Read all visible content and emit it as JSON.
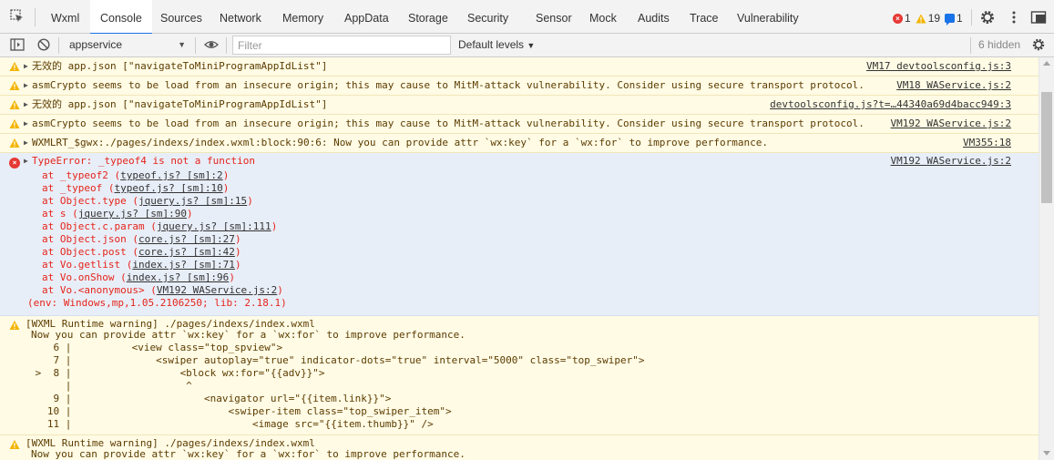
{
  "tabs": [
    {
      "label": "Wxml"
    },
    {
      "label": "Console"
    },
    {
      "label": "Sources"
    },
    {
      "label": "Network"
    },
    {
      "label": "Memory"
    },
    {
      "label": "AppData"
    },
    {
      "label": "Storage"
    },
    {
      "label": "Security"
    },
    {
      "label": "Sensor"
    },
    {
      "label": "Mock"
    },
    {
      "label": "Audits"
    },
    {
      "label": "Trace"
    },
    {
      "label": "Vulnerability"
    }
  ],
  "active_tab": "Console",
  "counts": {
    "errors": "1",
    "warnings": "19",
    "info": "1"
  },
  "toolbar": {
    "context": "appservice",
    "filter_placeholder": "Filter",
    "levels": "Default levels",
    "hidden": "6 hidden"
  },
  "colors": {
    "warn_bg": "#fffbe5",
    "error_bg": "#e8eef8",
    "error_text": "#e5241a",
    "accent": "#1a73e8"
  },
  "messages": [
    {
      "level": "warning",
      "text": "无效的 app.json [\"navigateToMiniProgramAppIdList\"]",
      "source": "VM17 devtoolsconfig.js:3"
    },
    {
      "level": "warning",
      "text": "asmCrypto seems to be load from an insecure origin; this may cause to MitM-attack vulnerability. Consider using secure transport protocol.",
      "source": "VM18 WAService.js:2"
    },
    {
      "level": "warning",
      "text": "无效的 app.json [\"navigateToMiniProgramAppIdList\"]",
      "source": "devtoolsconfig.js?t=…44340a69d4bacc949:3"
    },
    {
      "level": "warning",
      "text": "asmCrypto seems to be load from an insecure origin; this may cause to MitM-attack vulnerability. Consider using secure transport protocol.",
      "source": "VM192 WAService.js:2"
    },
    {
      "level": "warning",
      "text": "WXMLRT_$gwx:./pages/indexs/index.wxml:block:90:6: Now you can provide attr `wx:key` for a `wx:for` to improve performance.",
      "source": "VM355:18"
    }
  ],
  "error": {
    "text": "TypeError: _typeof4 is not a function",
    "source": "VM192 WAService.js:2",
    "stack": [
      {
        "prefix": "at _typeof2 (",
        "link": "typeof.js? [sm]:2",
        "suffix": ")"
      },
      {
        "prefix": "at _typeof (",
        "link": "typeof.js? [sm]:10",
        "suffix": ")"
      },
      {
        "prefix": "at Object.type (",
        "link": "jquery.js? [sm]:15",
        "suffix": ")"
      },
      {
        "prefix": "at s (",
        "link": "jquery.js? [sm]:90",
        "suffix": ")"
      },
      {
        "prefix": "at Object.c.param (",
        "link": "jquery.js? [sm]:111",
        "suffix": ")"
      },
      {
        "prefix": "at Object.json (",
        "link": "core.js? [sm]:27",
        "suffix": ")"
      },
      {
        "prefix": "at Object.post (",
        "link": "core.js? [sm]:42",
        "suffix": ")"
      },
      {
        "prefix": "at Vo.getlist (",
        "link": "index.js? [sm]:71",
        "suffix": ")"
      },
      {
        "prefix": "at Vo.onShow (",
        "link": "index.js? [sm]:96",
        "suffix": ")"
      },
      {
        "prefix": "at Vo.<anonymous> (",
        "link": "VM192 WAService.js:2",
        "suffix": ")"
      }
    ],
    "env": "(env: Windows,mp,1.05.2106250; lib: 2.18.1)"
  },
  "wxml_warning": {
    "title": "[WXML Runtime warning] ./pages/indexs/index.wxml",
    "subtitle": "Now you can provide attr `wx:key` for a `wx:for` to improve performance.",
    "code": [
      "    6 |          <view class=\"top_spview\">",
      "    7 |              <swiper autoplay=\"true\" indicator-dots=\"true\" interval=\"5000\" class=\"top_swiper\">",
      " >  8 |                  <block wx:for=\"{{adv}}\">",
      "      |                   ^",
      "    9 |                      <navigator url=\"{{item.link}}\">",
      "   10 |                          <swiper-item class=\"top_swiper_item\">",
      "   11 |                              <image src=\"{{item.thumb}}\" />"
    ]
  },
  "wxml_warning_2": {
    "title": "[WXML Runtime warning] ./pages/indexs/index.wxml",
    "subtitle": "Now you can provide attr `wx:key` for a `wx:for` to improve performance."
  }
}
